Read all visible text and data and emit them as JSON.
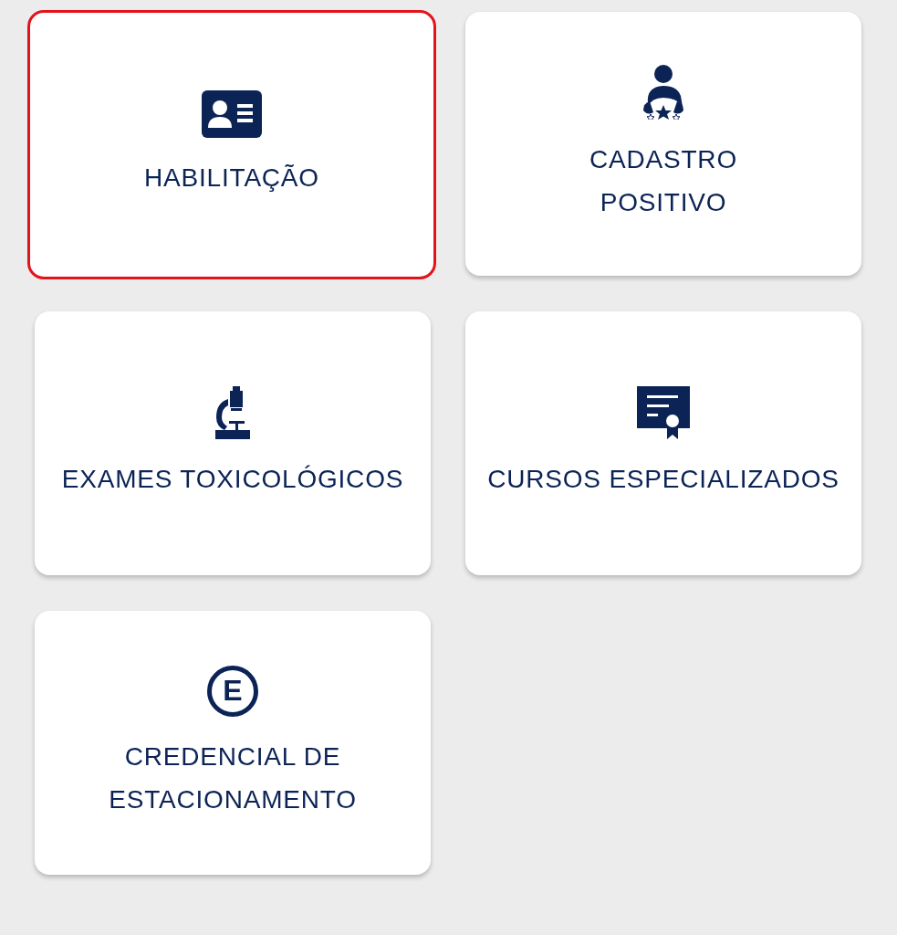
{
  "tiles": [
    {
      "label": "HABILITAÇÃO",
      "kind": "card",
      "selected": true
    },
    {
      "label": "CADASTRO POSITIVO",
      "kind": "driver",
      "selected": false
    },
    {
      "label": "EXAMES TOXICOLÓGICOS",
      "kind": "microscope",
      "selected": false
    },
    {
      "label": "CURSOS ESPECIALIZADOS",
      "kind": "certificate",
      "selected": false
    },
    {
      "label": "CREDENCIAL DE ESTACIONAMENTO",
      "kind": "letter",
      "symbol": "E",
      "selected": false
    }
  ]
}
